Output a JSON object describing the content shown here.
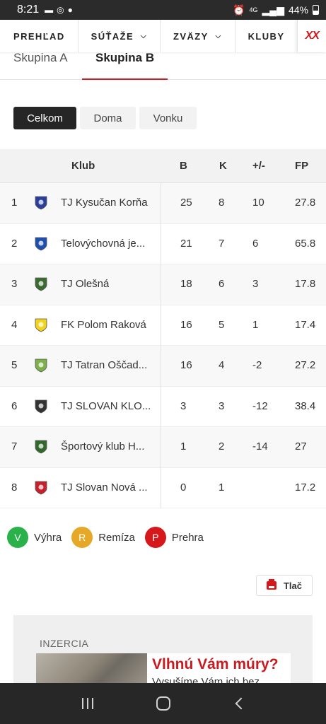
{
  "status_bar": {
    "time": "8:21",
    "network": "4G",
    "battery": "44%"
  },
  "nav": {
    "items": [
      {
        "label": "PREHĽAD",
        "has_dropdown": false
      },
      {
        "label": "SÚŤAŽE",
        "has_dropdown": true
      },
      {
        "label": "ZVÄZY",
        "has_dropdown": true
      },
      {
        "label": "KLUBY",
        "has_dropdown": false
      }
    ],
    "logo_text": "XX"
  },
  "group_tabs": [
    {
      "label": "Skupina A",
      "active": false
    },
    {
      "label": "Skupina B",
      "active": true
    }
  ],
  "filters": [
    {
      "label": "Celkom",
      "active": true
    },
    {
      "label": "Doma",
      "active": false
    },
    {
      "label": "Vonku",
      "active": false
    }
  ],
  "table": {
    "headers": {
      "club": "Klub",
      "b": "B",
      "k": "K",
      "diff": "+/-",
      "fp": "FP"
    },
    "rows": [
      {
        "rank": "1",
        "club": "TJ Kysučan Korňa",
        "b": "25",
        "k": "8",
        "diff": "10",
        "fp": "27.8",
        "logo_color": "#2a3f9b"
      },
      {
        "rank": "2",
        "club": "Telovýchovná je...",
        "b": "21",
        "k": "7",
        "diff": "6",
        "fp": "65.8",
        "logo_color": "#1c4fb0"
      },
      {
        "rank": "3",
        "club": "TJ Olešná",
        "b": "18",
        "k": "6",
        "diff": "3",
        "fp": "17.8",
        "logo_color": "#3a6b2f"
      },
      {
        "rank": "4",
        "club": "FK Polom Raková",
        "b": "16",
        "k": "5",
        "diff": "1",
        "fp": "17.4",
        "logo_color": "#f2d31b"
      },
      {
        "rank": "5",
        "club": "TJ Tatran Oščad...",
        "b": "16",
        "k": "4",
        "diff": "-2",
        "fp": "27.2",
        "logo_color": "#7bb04a"
      },
      {
        "rank": "6",
        "club": "TJ SLOVAN KLO...",
        "b": "3",
        "k": "3",
        "diff": "-12",
        "fp": "38.4",
        "logo_color": "#333333"
      },
      {
        "rank": "7",
        "club": "Športový klub H...",
        "b": "1",
        "k": "2",
        "diff": "-14",
        "fp": "27",
        "logo_color": "#2f6a2a"
      },
      {
        "rank": "8",
        "club": "TJ Slovan Nová ...",
        "b": "0",
        "k": "1",
        "diff": "",
        "fp": "17.2",
        "logo_color": "#c8202a"
      }
    ]
  },
  "legend": [
    {
      "letter": "V",
      "label": "Výhra",
      "color": "#2ab24a"
    },
    {
      "letter": "R",
      "label": "Remíza",
      "color": "#e5a927"
    },
    {
      "letter": "P",
      "label": "Prehra",
      "color": "#d6171b"
    }
  ],
  "print": {
    "label": "Tlač"
  },
  "ad": {
    "label": "INZERCIA",
    "headline": "Vlhnú Vám múry?",
    "subtext": "Vysušíme Vám ich bez"
  },
  "colors": {
    "accent": "#d6171b",
    "active_filter": "#262626"
  }
}
